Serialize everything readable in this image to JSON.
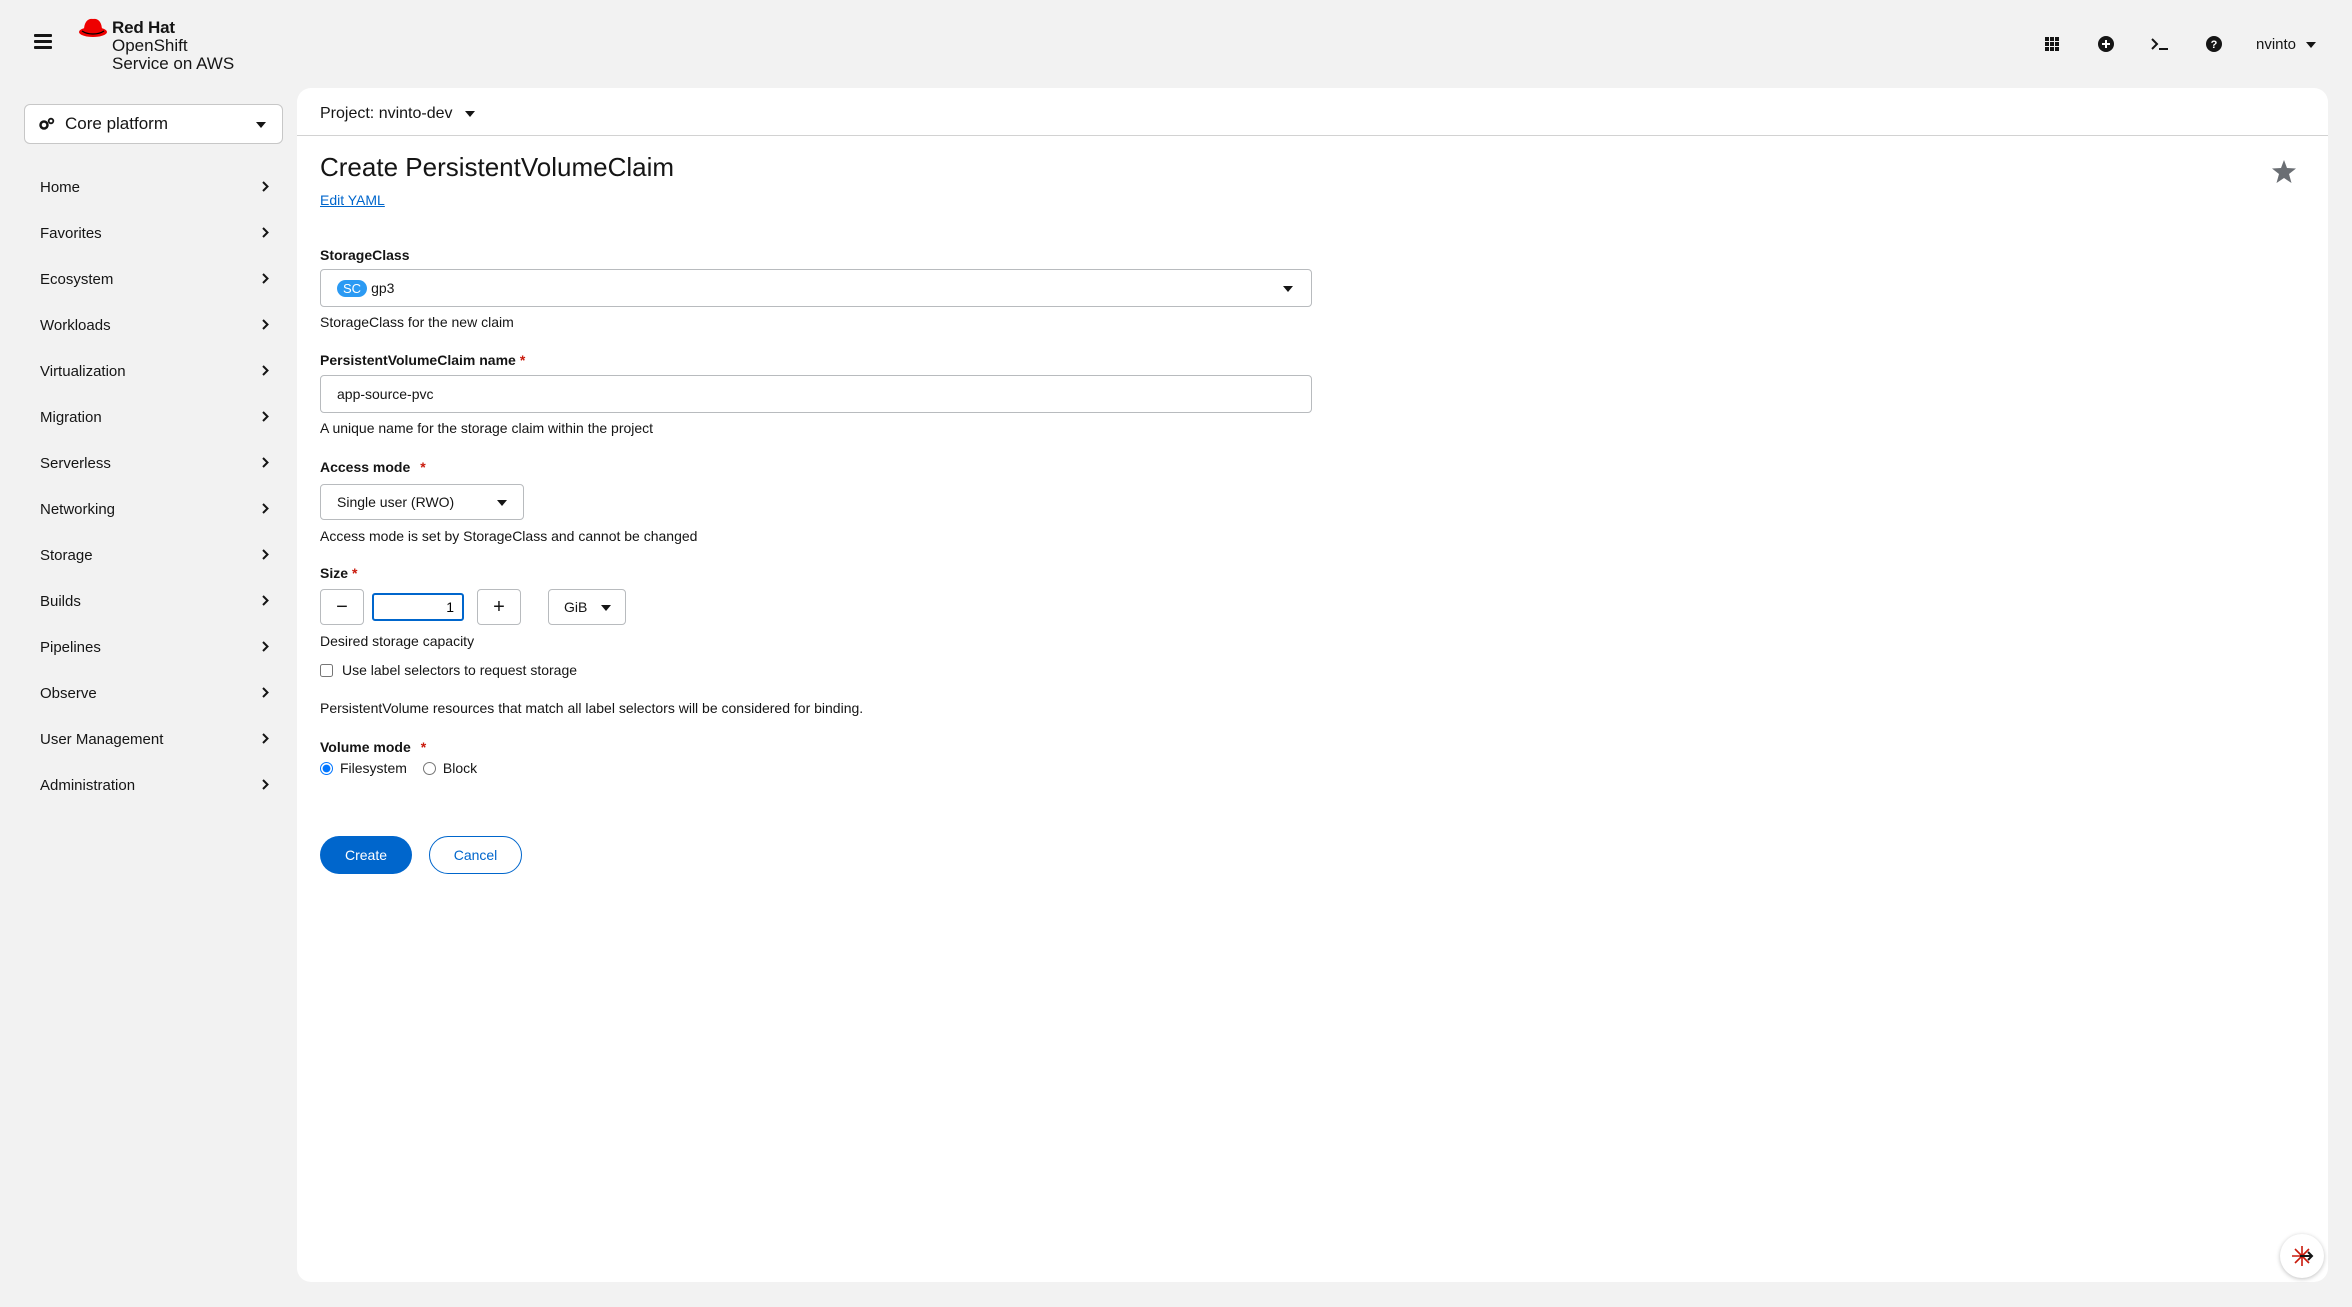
{
  "brand": {
    "line1": "Red Hat",
    "line2": "OpenShift",
    "line3": "Service on AWS",
    "color": "#ee0000"
  },
  "masthead": {
    "icons": [
      "grid-icon",
      "plus-circle-icon",
      "terminal-icon",
      "help-icon"
    ],
    "user": "nvinto"
  },
  "perspective": {
    "label": "Core platform",
    "icon": "cogs-icon"
  },
  "nav": {
    "items": [
      {
        "label": "Home"
      },
      {
        "label": "Favorites"
      },
      {
        "label": "Ecosystem"
      },
      {
        "label": "Workloads"
      },
      {
        "label": "Virtualization"
      },
      {
        "label": "Migration"
      },
      {
        "label": "Serverless"
      },
      {
        "label": "Networking"
      },
      {
        "label": "Storage"
      },
      {
        "label": "Builds"
      },
      {
        "label": "Pipelines"
      },
      {
        "label": "Observe"
      },
      {
        "label": "User Management"
      },
      {
        "label": "Administration"
      }
    ]
  },
  "project": {
    "label": "Project: nvinto-dev"
  },
  "page": {
    "title": "Create PersistentVolumeClaim",
    "edit_yaml": "Edit YAML"
  },
  "form": {
    "storage_class": {
      "label": "StorageClass",
      "badge": "SC",
      "value": "gp3",
      "help": "StorageClass for the new claim"
    },
    "pvc_name": {
      "label": "PersistentVolumeClaim name",
      "required": "*",
      "value": "app-source-pvc",
      "help": "A unique name for the storage claim within the project"
    },
    "access_mode": {
      "label": "Access mode",
      "required": "*",
      "value": "Single user (RWO)",
      "help": "Access mode is set by StorageClass and cannot be changed"
    },
    "size": {
      "label": "Size",
      "required": "*",
      "minus": "−",
      "plus": "+",
      "value": "1",
      "unit": "GiB",
      "help": "Desired storage capacity"
    },
    "label_selector": {
      "label": "Use label selectors to request storage",
      "checked": false,
      "help": "PersistentVolume resources that match all label selectors will be considered for binding."
    },
    "volume_mode": {
      "label": "Volume mode",
      "required": "*",
      "options": [
        "Filesystem",
        "Block"
      ],
      "selected": "Filesystem"
    }
  },
  "actions": {
    "create": "Create",
    "cancel": "Cancel"
  },
  "colors": {
    "primary": "#0066cc",
    "required": "#c9190b",
    "badge": "#2b9af3"
  }
}
